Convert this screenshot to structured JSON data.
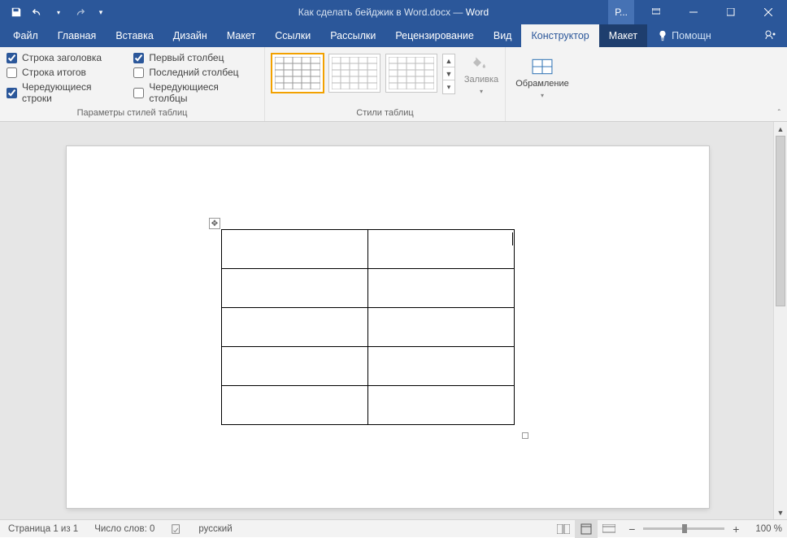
{
  "titlebar": {
    "doc_title": "Как сделать бейджик в Word.docx",
    "dash": " — ",
    "app_name": "Word",
    "account_short": "Р...",
    "qat": {
      "save": "save-icon",
      "undo": "undo-icon",
      "redo": "redo-icon",
      "customize": "customize-qat"
    }
  },
  "menu": {
    "file": "Файл",
    "home": "Главная",
    "insert": "Вставка",
    "design": "Дизайн",
    "layout": "Макет",
    "references": "Ссылки",
    "mailings": "Рассылки",
    "review": "Рецензирование",
    "view": "Вид",
    "table_design": "Конструктор",
    "table_layout": "Макет",
    "tell_me": "Помощн"
  },
  "ribbon": {
    "options": {
      "header_row": "Строка заголовка",
      "total_row": "Строка итогов",
      "banded_rows": "Чередующиеся строки",
      "first_col": "Первый столбец",
      "last_col": "Последний столбец",
      "banded_cols": "Чередующиеся столбцы",
      "group_label": "Параметры стилей таблиц"
    },
    "styles": {
      "group_label": "Стили таблиц",
      "shading": "Заливка",
      "borders": "Обрамление"
    },
    "checked": {
      "header_row": true,
      "total_row": false,
      "banded_rows": true,
      "first_col": true,
      "last_col": false,
      "banded_cols": false
    }
  },
  "document": {
    "table": {
      "rows": 5,
      "cols": 2
    }
  },
  "statusbar": {
    "page": "Страница 1 из 1",
    "words": "Число слов: 0",
    "language": "русский",
    "zoom": "100 %"
  }
}
